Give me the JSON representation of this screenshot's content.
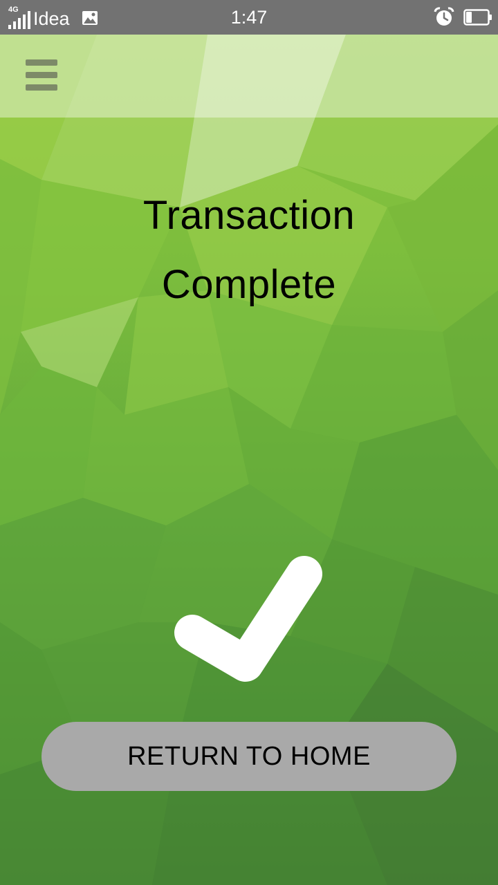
{
  "status_bar": {
    "network_type": "4G",
    "carrier": "Idea",
    "time": "1:47",
    "icons": [
      "signal-icon",
      "image-notification-icon",
      "alarm-clock-icon",
      "battery-icon"
    ],
    "battery_level": 0.25
  },
  "app_bar": {
    "menu_icon": "hamburger-menu-icon"
  },
  "main": {
    "title_line1": "Transaction",
    "title_line2": "Complete",
    "status_icon": "checkmark-icon",
    "return_button_label": "RETURN TO HOME"
  },
  "colors": {
    "background_top": "#8cc63f",
    "background_bottom": "#427a33",
    "status_bar": "#727272",
    "button": "#a9a9a9",
    "menu_icon": "#7d8a68",
    "checkmark": "#ffffff"
  }
}
